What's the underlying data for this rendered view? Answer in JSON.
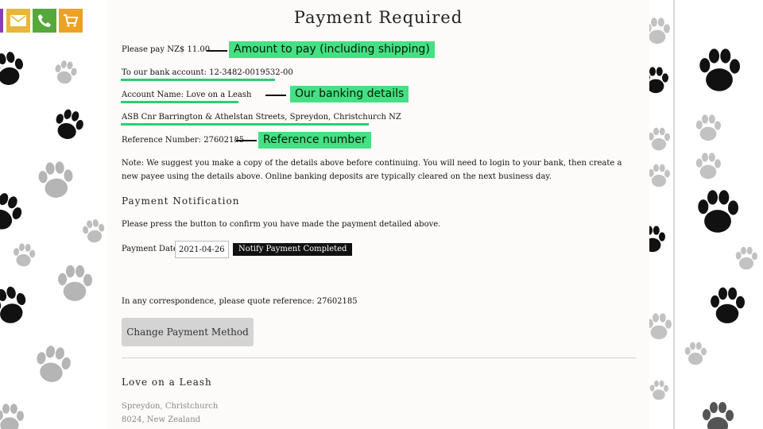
{
  "page": {
    "title": "Payment Required",
    "pay_line": "Please pay NZ$ 11.00",
    "bank_account_line": "To our bank account: 12-3482-0019532-00",
    "account_name_line": "Account Name: Love on a Leash",
    "branch_line": "ASB Cnr Barrington & Athelstan Streets, Spreydon, Christchurch NZ",
    "reference_line": "Reference Number: 27602185",
    "note": "Note: We suggest you make a copy of the details above before continuing. You will need to login to your bank, then create a new payee using the details above. Online banking deposits are typically cleared on the next business day."
  },
  "callouts": {
    "amount": "Amount to pay (including shipping)",
    "banking": "Our banking details",
    "reference": "Reference number"
  },
  "notification": {
    "heading": "Payment Notification",
    "instruction": "Please press the button to confirm you have made the payment detailed above.",
    "date_label": "Payment Date:",
    "date_value": "2021-04-26",
    "notify_button": "Notify Payment Completed"
  },
  "correspondence": "In any correspondence, please quote reference: 27602185",
  "change_method_button": "Change Payment Method",
  "footer": {
    "business_name": "Love on a Leash",
    "address_line1": "Spreydon, Christchurch",
    "address_line2": "8024, New Zealand"
  },
  "contact_icons": [
    {
      "name": "mail-icon",
      "color": "#e8b73a"
    },
    {
      "name": "phone-icon",
      "color": "#57a83b"
    },
    {
      "name": "cart-icon",
      "color": "#eea223"
    }
  ],
  "colors": {
    "highlight": "#45e083",
    "underline": "#2ecc71",
    "notify_button_bg": "#111111",
    "change_button_bg": "#d4d4d4"
  }
}
